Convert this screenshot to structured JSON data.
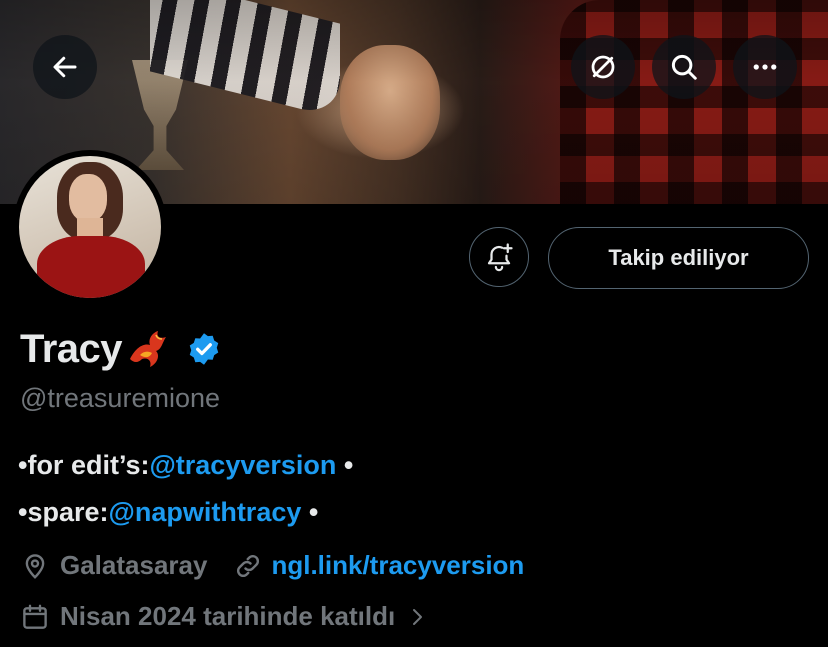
{
  "header": {
    "back_icon": "arrow-left-icon",
    "actions": [
      "fast-forward-circle-icon",
      "search-icon",
      "more-icon"
    ]
  },
  "profile": {
    "display_name": "Tracy",
    "name_emoji": "phoenix-icon",
    "verified": true,
    "handle": "@treasuremione",
    "notify_icon": "bell-plus-icon",
    "follow_label": "Takip ediliyor",
    "bio": {
      "line1": {
        "prefix": "•for edit’s:",
        "mention": "@tracyversion",
        "suffix": " •"
      },
      "line2": {
        "prefix": "•spare:",
        "mention": "@napwithtracy",
        "suffix": " •"
      }
    },
    "location": "Galatasaray",
    "website": "ngl.link/tracyversion",
    "joined": "Nisan 2024 tarihinde katıldı"
  },
  "colors": {
    "background": "#000000",
    "text": "#e7e9ea",
    "muted": "#71767b",
    "accent": "#1d9bf0",
    "border": "#536471"
  }
}
